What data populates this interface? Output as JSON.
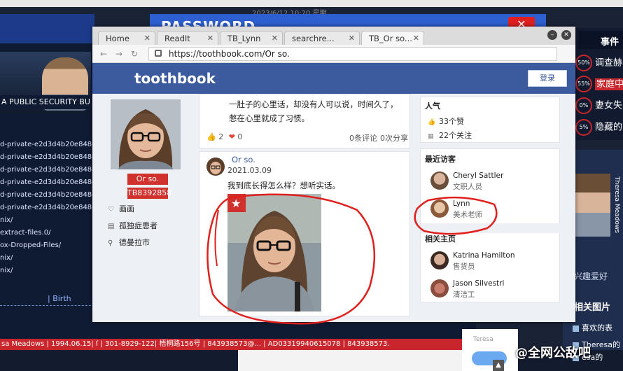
{
  "background": {
    "password_banner": "PASSWORD",
    "password_date": "2023/6/12   10:20   星期",
    "left_panel": {
      "title": "A PUBLIC SECURITY BU",
      "files": [
        "d-private-e2d3d4b20e848g5",
        "d-private-e2d3d4b20e848g5",
        "d-private-e2d3d4b20e848g5",
        "d-private-e2d3d4b20e848g5",
        "d-private-e2d3d4b20e848g5",
        "d-private-e2d3d4b20e848g5",
        "nix/",
        "extract-files.0/",
        "ox-Dropped-Files/",
        "nix/",
        "nix/"
      ],
      "birth_label": "| Birth"
    },
    "red_bar": "sa Meadows | 1994.06.15| ſ  | 301-8929-122| 梧桐路156号  |  843938573@...  | AD03319940615078 | 843938573.",
    "events_panel": {
      "title": "事件",
      "items": [
        {
          "pct": "50%",
          "text": "调查赫"
        },
        {
          "pct": "55%",
          "text": "家庭中"
        },
        {
          "pct": "0%",
          "text": "妻女失"
        },
        {
          "pct": "5%",
          "text": "隐藏的"
        }
      ]
    },
    "profile_strip": {
      "vertical_name": "Theresa Meadows",
      "hobby": "兴趣爱好",
      "images_title": "相关图片",
      "tags": [
        "喜欢的表",
        "Theresa的",
        "esa的"
      ]
    },
    "chat_preview": "Teresa"
  },
  "browser": {
    "tabs": [
      {
        "label": "Home",
        "active": false
      },
      {
        "label": "ReadIt",
        "active": false
      },
      {
        "label": "TB_Lynn",
        "active": false
      },
      {
        "label": "searchre...",
        "active": false
      },
      {
        "label": "TB_Or so...",
        "active": true
      }
    ],
    "url": "https://toothbook.com/Or so."
  },
  "site": {
    "logo": "toothbook",
    "login_label": "登录",
    "profile": {
      "name": "Or so.",
      "id": "TB8392858",
      "info": [
        {
          "icon": "heart-icon",
          "text": "画画"
        },
        {
          "icon": "id-card-icon",
          "text": "孤独症患者"
        },
        {
          "icon": "location-icon",
          "text": "德曼拉市"
        }
      ]
    },
    "posts": [
      {
        "text": "一肚子的心里话，却没有人可以说，时间久了，憋在心里就成了习惯。",
        "likes": "2",
        "hearts": "0",
        "comments": "0条评论",
        "shares": "0次分享"
      },
      {
        "author": "Or so.",
        "date": "2021.03.09",
        "text": "我到底长得怎么样？想听实话。"
      }
    ],
    "sidebar": {
      "popularity_title": "人气",
      "likes": "33个赞",
      "followers": "22个关注",
      "recent_visitors_title": "最近访客",
      "recent_visitors": [
        {
          "name": "Cheryl Sattler",
          "job": "文职人员"
        },
        {
          "name": "Lynn",
          "job": "美术老师"
        }
      ],
      "related_title": "相关主页",
      "related": [
        {
          "name": "Katrina Hamilton",
          "job": "售货员"
        },
        {
          "name": "Jason Silvestri",
          "job": "清洁工"
        }
      ]
    }
  },
  "watermark": "@全网公敌吧",
  "colors": {
    "brand_blue": "#3b5b9e",
    "name_red": "#d0312d",
    "annotation_red": "#e0201c"
  }
}
